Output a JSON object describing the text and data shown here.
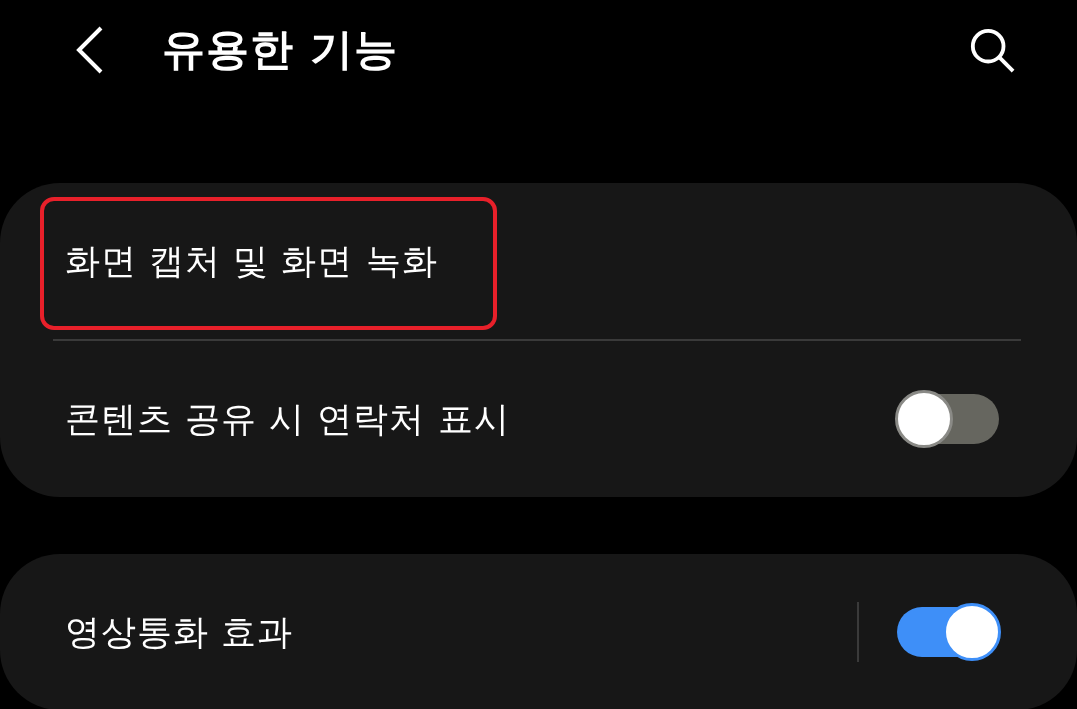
{
  "header": {
    "title": "유용한 기능"
  },
  "sections": [
    {
      "items": [
        {
          "kind": "link",
          "label": "화면 캡처 및 화면 녹화",
          "highlighted": true
        },
        {
          "kind": "switch",
          "label": "콘텐츠 공유 시 연락처 표시",
          "on": false,
          "split": false
        }
      ]
    },
    {
      "items": [
        {
          "kind": "switch",
          "label": "영상통화 효과",
          "on": true,
          "split": true
        }
      ]
    }
  ]
}
